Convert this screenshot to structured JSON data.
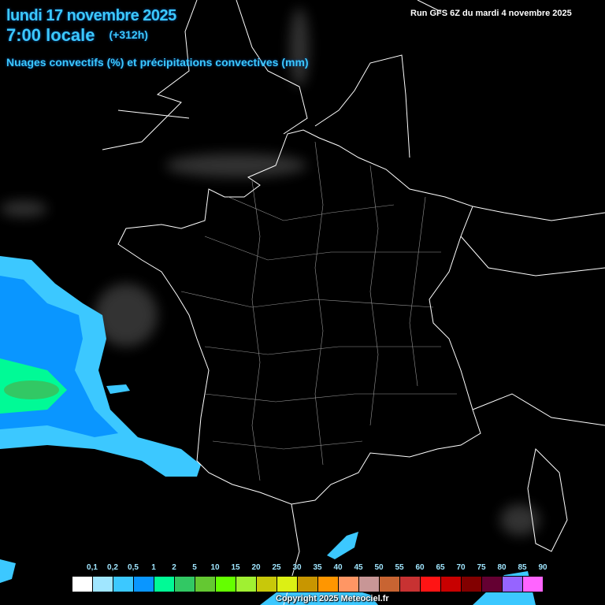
{
  "header": {
    "date": "lundi 17 novembre 2025",
    "time": "7:00 locale",
    "offset": "(+312h)",
    "subtitle": "Nuages convectifs (%) et précipitations convectives (mm)",
    "run": "Run GFS 6Z du mardi 4 novembre 2025"
  },
  "legend": {
    "labels": [
      "0,1",
      "0,2",
      "0,5",
      "1",
      "2",
      "5",
      "10",
      "15",
      "20",
      "25",
      "30",
      "35",
      "40",
      "45",
      "50",
      "55",
      "60",
      "65",
      "70",
      "75",
      "80",
      "85",
      "90"
    ],
    "colors": [
      "#ffffff",
      "#a0e6ff",
      "#3cc8ff",
      "#0a96ff",
      "#00fa96",
      "#32c864",
      "#64c832",
      "#64ff00",
      "#a0f032",
      "#c8c80a",
      "#dcf014",
      "#c89600",
      "#ff9600",
      "#ff9664",
      "#c89696",
      "#c86432",
      "#c83232",
      "#ff1414",
      "#c80000",
      "#820000",
      "#640032",
      "#9664ff",
      "#ff64ff"
    ]
  },
  "footer": {
    "copyright": "Copyright 2025 Meteociel.fr"
  }
}
